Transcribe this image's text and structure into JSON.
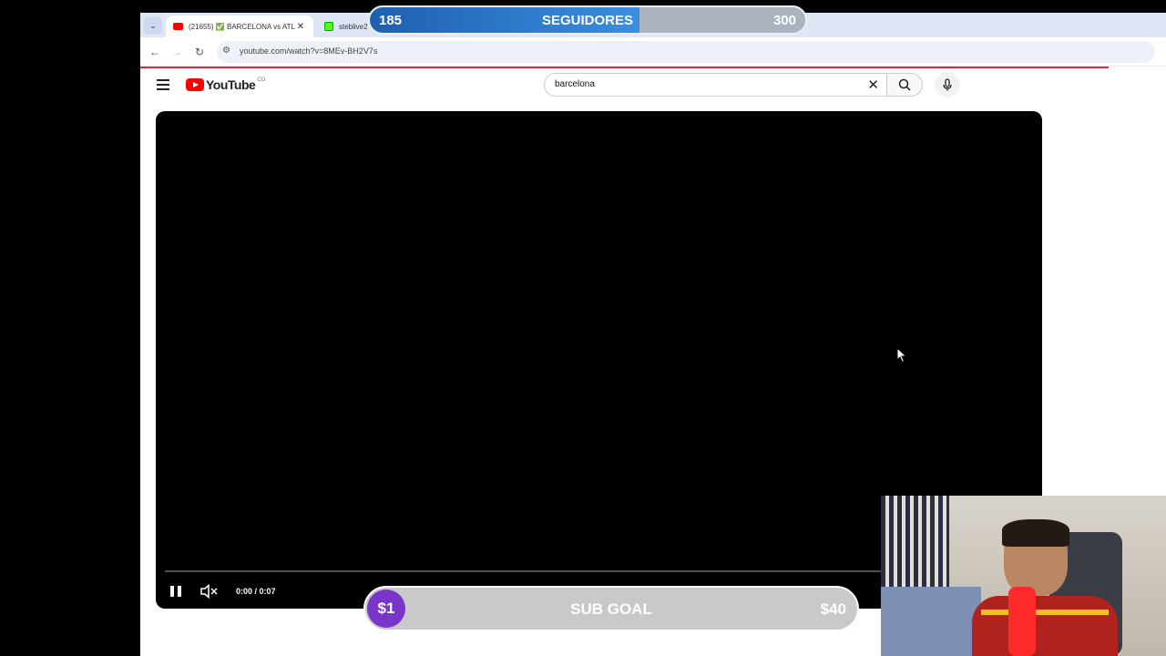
{
  "browser": {
    "tabs": [
      {
        "title": "(21655) ✅ BARCELONA vs ATL",
        "active": true
      },
      {
        "title": "steblive2",
        "active": false
      }
    ],
    "url": "youtube.com/watch?v=8MEv-BH2V7s"
  },
  "youtube": {
    "logo_text": "YouTube",
    "country_code": "CO",
    "search": {
      "value": "barcelona"
    }
  },
  "player": {
    "time": "0:00 / 0:07",
    "state": "playing",
    "muted": true
  },
  "overlays": {
    "followers_goal": {
      "current": "185",
      "title": "SEGUIDORES",
      "goal": "300",
      "progress": 0.62,
      "color": "#2c76cf"
    },
    "sub_goal": {
      "current": "$1",
      "title": "SUB GOAL",
      "goal": "$40",
      "badge_color": "#7b34c9"
    }
  },
  "colors": {
    "youtube_red": "#ff0000",
    "loading_bar": "#e0263f"
  }
}
